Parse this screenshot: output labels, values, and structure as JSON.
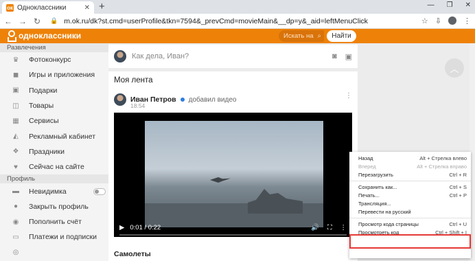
{
  "browser": {
    "tab_title": "Одноклассники",
    "url": "m.ok.ru/dk?st.cmd=userProfile&tkn=7594&_prevCmd=movieMain&__dp=y&_aid=leftMenuClick"
  },
  "header": {
    "logo_text": "одноклассники",
    "search_placeholder": "Искать на",
    "find_button": "Найти"
  },
  "sidebar": {
    "section1": "Развлечения",
    "items1": [
      {
        "label": "Фотоконкурс",
        "icon": "trophy-icon",
        "glyph": "♛"
      },
      {
        "label": "Игры и приложения",
        "icon": "gamepad-icon",
        "glyph": "◼"
      },
      {
        "label": "Подарки",
        "icon": "gift-icon",
        "glyph": "▣"
      },
      {
        "label": "Товары",
        "icon": "bag-icon",
        "glyph": "◫"
      },
      {
        "label": "Сервисы",
        "icon": "grid-icon",
        "glyph": "▦"
      },
      {
        "label": "Рекламный кабинет",
        "icon": "megaphone-icon",
        "glyph": "◭"
      },
      {
        "label": "Праздники",
        "icon": "cake-icon",
        "glyph": "❖"
      },
      {
        "label": "Сейчас на сайте",
        "icon": "heart-icon",
        "glyph": "♥"
      }
    ],
    "section2": "Профиль",
    "items2": [
      {
        "label": "Невидимка",
        "icon": "hat-icon",
        "glyph": "▬"
      },
      {
        "label": "Закрыть профиль",
        "icon": "lock-icon",
        "glyph": "●"
      },
      {
        "label": "Пополнить счёт",
        "icon": "coin-icon",
        "glyph": "◉"
      },
      {
        "label": "Платежи и подписки",
        "icon": "card-icon",
        "glyph": "▭"
      },
      {
        "label": "",
        "icon": "settings-icon",
        "glyph": "◎"
      }
    ]
  },
  "post_box": {
    "placeholder": "Как дела, Иван?"
  },
  "feed": {
    "title": "Моя лента",
    "author": "Иван Петров",
    "action": "добавил видео",
    "time": "18:54",
    "video_time": "0:01 / 0:22",
    "caption": "Самолеты"
  },
  "context_menu": {
    "items": [
      {
        "label": "Назад",
        "shortcut": "Alt + Стрелка влево",
        "disabled": false
      },
      {
        "label": "Вперед",
        "shortcut": "Alt + Стрелка вправо",
        "disabled": true
      },
      {
        "label": "Перезагрузить",
        "shortcut": "Ctrl + R",
        "disabled": false
      },
      {
        "sep": true
      },
      {
        "label": "Сохранить как...",
        "shortcut": "Ctrl + S",
        "disabled": false
      },
      {
        "label": "Печать...",
        "shortcut": "Ctrl + P",
        "disabled": false
      },
      {
        "label": "Трансляция...",
        "shortcut": "",
        "disabled": false
      },
      {
        "label": "Перевести на русский",
        "shortcut": "",
        "disabled": false
      },
      {
        "sep": true
      },
      {
        "label": "Просмотр кода страницы",
        "shortcut": "Ctrl + U",
        "disabled": false
      },
      {
        "label": "Просмотреть код",
        "shortcut": "Ctrl + Shift + I",
        "disabled": false
      }
    ]
  },
  "colors": {
    "brand": "#ee8208",
    "highlight": "#e53935"
  }
}
